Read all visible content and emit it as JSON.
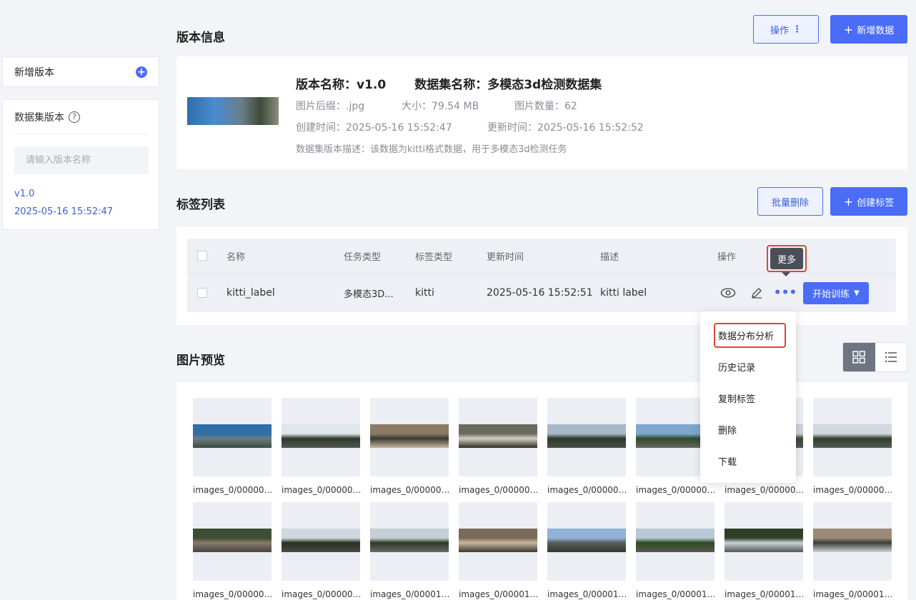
{
  "sidebar": {
    "add_version_label": "新增版本",
    "dataset_version_title": "数据集版本",
    "search_placeholder": "请输入版本名称",
    "versions": [
      {
        "name": "v1.0",
        "date": "2025-05-16 15:52:47"
      }
    ]
  },
  "version_info": {
    "title": "版本信息",
    "ops_label": "操作",
    "add_data_label": "新增数据",
    "name_label": "版本名称：",
    "name_value": "v1.0",
    "dataset_label": "数据集名称：",
    "dataset_value": "多模态3d检测数据集",
    "suffix_label": "图片后缀：",
    "suffix_value": ".jpg",
    "size_label": "大小：",
    "size_value": "79.54 MB",
    "count_label": "图片数量：",
    "count_value": "62",
    "created_label": "创建时间：",
    "created_value": "2025-05-16 15:52:47",
    "updated_label": "更新时间：",
    "updated_value": "2025-05-16 15:52:52",
    "desc_label": "数据集版本描述：",
    "desc_value": "该数据为kitti格式数据，用于多模态3d检测任务"
  },
  "label_list": {
    "title": "标签列表",
    "batch_delete_label": "批量删除",
    "create_label": "创建标签",
    "columns": {
      "name": "名称",
      "task_type": "任务类型",
      "label_type": "标签类型",
      "updated": "更新时间",
      "desc": "描述",
      "ops": "操作"
    },
    "rows": [
      {
        "name": "kitti_label",
        "task_type": "多模态3D...",
        "label_type": "kitti",
        "updated": "2025-05-16 15:52:51",
        "desc": "kitti label"
      }
    ],
    "train_label": "开始训练",
    "more_tooltip": "更多",
    "more_menu": [
      "数据分布分析",
      "历史记录",
      "复制标签",
      "删除",
      "下载"
    ]
  },
  "preview": {
    "title": "图片预览",
    "images": [
      {
        "caption": "images_0/00000…",
        "colors": [
          "#2f6ea8",
          "#6a7d88",
          "#3d4a38"
        ]
      },
      {
        "caption": "images_0/00000…",
        "colors": [
          "#dfe6ea",
          "#2f3a2a",
          "#555"
        ]
      },
      {
        "caption": "images_0/00000…",
        "colors": [
          "#8a7a66",
          "#3a3a32",
          "#c6b8a0"
        ]
      },
      {
        "caption": "images_0/00000…",
        "colors": [
          "#6b6a60",
          "#d4cfc4",
          "#2a2c22"
        ]
      },
      {
        "caption": "images_0/00000…",
        "colors": [
          "#a9b8c6",
          "#2d3a28",
          "#4a4d48"
        ]
      },
      {
        "caption": "images_0/00000…",
        "colors": [
          "#7fa6cc",
          "#2f4a2a",
          "#666"
        ]
      },
      {
        "caption": "images_0/00000…",
        "colors": [
          "#c9d3d9",
          "#3a4a30",
          "#555"
        ]
      },
      {
        "caption": "images_0/00000…",
        "colors": [
          "#d0d7de",
          "#2f3f26",
          "#5a5a5a"
        ]
      },
      {
        "caption": "images_0/00000…",
        "colors": [
          "#3d4d36",
          "#8a7a6a",
          "#444"
        ]
      },
      {
        "caption": "images_0/00000…",
        "colors": [
          "#cfd8de",
          "#26321f",
          "#4a4a4a"
        ]
      },
      {
        "caption": "images_0/00001…",
        "colors": [
          "#c4cfd6",
          "#2a3a22",
          "#6a6a6a"
        ]
      },
      {
        "caption": "images_0/00001…",
        "colors": [
          "#7a6a58",
          "#c7b89e",
          "#3a3a30"
        ]
      },
      {
        "caption": "images_0/00001…",
        "colors": [
          "#8fb2d6",
          "#5a5d5a",
          "#2f3a2a"
        ]
      },
      {
        "caption": "images_0/00001…",
        "colors": [
          "#b8c8d4",
          "#2e4a22",
          "#5a5a52"
        ]
      },
      {
        "caption": "images_0/00001…",
        "colors": [
          "#2f3f26",
          "#c9d4da",
          "#555"
        ]
      },
      {
        "caption": "images_0/00001…",
        "colors": [
          "#9a8a78",
          "#3a3d36",
          "#d0d4d8"
        ]
      }
    ]
  }
}
